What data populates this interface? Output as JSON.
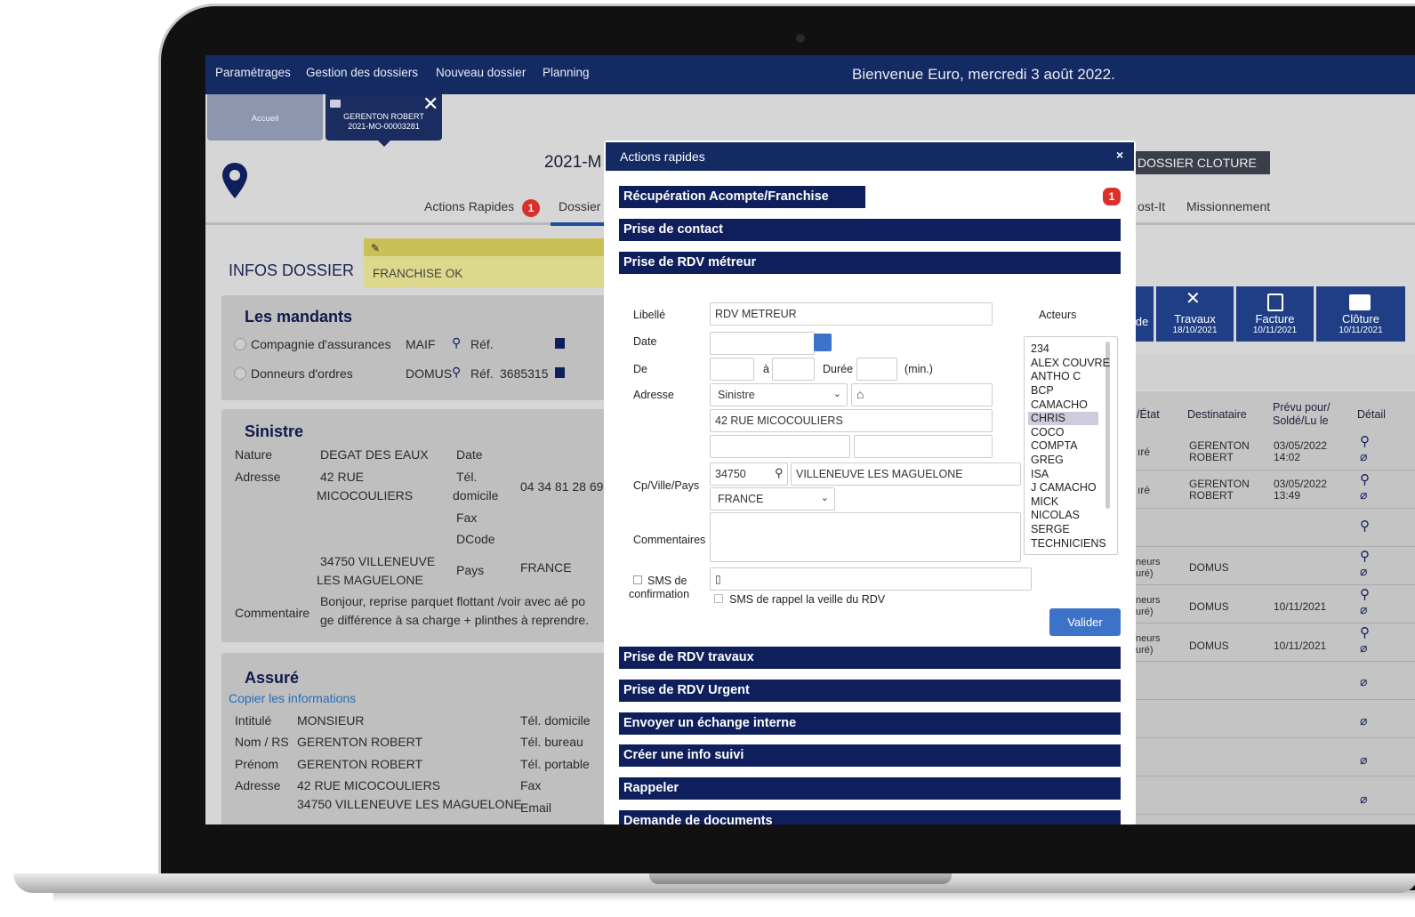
{
  "nav": {
    "items": [
      "Paramétrages",
      "Gestion des dossiers",
      "Nouveau dossier",
      "Planning"
    ],
    "welcome": "Bienvenue Euro, mercredi 3 août 2022."
  },
  "tabs": {
    "home": "Accueil",
    "dossier_line1": "GERENTON ROBERT",
    "dossier_line2": "2021-MO-00003281"
  },
  "dossier": {
    "number": "2021-M",
    "tab_actions": "Actions Rapides",
    "tab_actions_badge": "1",
    "tab_dossier": "Dossier",
    "cloture": "DOSSIER CLOTURE",
    "tab_postit": "ost-It",
    "tab_mission": "Missionnement"
  },
  "infos": {
    "title": "INFOS DOSSIER",
    "postit": "FRANCHISE OK"
  },
  "mandants": {
    "title": "Les mandants",
    "row1_label": "Compagnie d'assurances",
    "row1_value": "MAIF",
    "row1_ref": "Réf.",
    "row2_label": "Donneurs d'ordres",
    "row2_value": "DOMUS",
    "row2_ref": "Réf.",
    "row2_ref_value": "3685315"
  },
  "sinistre": {
    "title": "Sinistre",
    "nature_label": "Nature",
    "nature": "DEGAT DES EAUX",
    "date_label": "Date",
    "adresse_label": "Adresse",
    "adresse1": "42 RUE",
    "adresse2": "MICOCOULIERS",
    "tel_label1": "Tél.",
    "tel_label2": "domicile",
    "tel": "04 34 81 28 69",
    "fax_label": "Fax",
    "dcode_label": "DCode",
    "ville1": "34750 VILLENEUVE",
    "ville2": "LES MAGUELONE",
    "pays_label": "Pays",
    "pays": "FRANCE",
    "comment_label": "Commentaire",
    "comment1": "Bonjour, reprise parquet flottant /voir avec aé po",
    "comment2": "ge différence à sa charge + plinthes à reprendre."
  },
  "assure": {
    "title": "Assuré",
    "copy": "Copier les informations",
    "intitule_label": "Intitulé",
    "intitule": "MONSIEUR",
    "nom_label": "Nom / RS",
    "nom": "GERENTON ROBERT",
    "prenom_label": "Prénom",
    "prenom": "GERENTON ROBERT",
    "adresse_label": "Adresse",
    "adresse1": "42 RUE MICOCOULIERS",
    "adresse2": "34750 VILLENEUVE LES MAGUELONE",
    "tel_dom": "Tél. domicile",
    "tel_bur": "Tél. bureau",
    "tel_port": "Tél. portable",
    "fax": "Fax",
    "email": "Email"
  },
  "right": {
    "btn_partial": "de",
    "btn1_label": "Travaux",
    "btn1_date": "18/10/2021",
    "btn2_label": "Facture",
    "btn2_date": "10/11/2021",
    "btn3_label": "Clôture",
    "btn3_date": "10/11/2021",
    "col_etat": "/État",
    "col_dest": "Destinataire",
    "col_prevu1": "Prévu pour/",
    "col_prevu2": "Soldé/Lu le",
    "col_detail": "Détail",
    "rows": [
      {
        "etat": "ıré",
        "dest1": "GERENTON",
        "dest2": "ROBERT",
        "date1": "03/05/2022",
        "date2": "14:02"
      },
      {
        "etat": "ıré",
        "dest1": "GERENTON",
        "dest2": "ROBERT",
        "date1": "03/05/2022",
        "date2": "13:49"
      },
      {
        "etat": "",
        "dest1": "",
        "dest2": "",
        "date1": "",
        "date2": ""
      },
      {
        "etat": "neurs\nuré)",
        "dest1": "DOMUS",
        "dest2": "",
        "date1": "",
        "date2": ""
      },
      {
        "etat": "neurs\nuré)",
        "dest1": "DOMUS",
        "dest2": "",
        "date1": "10/11/2021",
        "date2": ""
      },
      {
        "etat": "neurs\nuré)",
        "dest1": "DOMUS",
        "dest2": "",
        "date1": "10/11/2021",
        "date2": ""
      }
    ]
  },
  "modal": {
    "title": "Actions rapides",
    "close": "×",
    "sections_top": [
      "Récupération Acompte/Franchise",
      "Prise de contact",
      "Prise de RDV métreur"
    ],
    "badge": "1",
    "form": {
      "libelle_label": "Libellé",
      "libelle_value": "RDV METREUR",
      "date_label": "Date",
      "de_label": "De",
      "a_label": "à",
      "duree_label": "Durée",
      "min_label": "(min.)",
      "adresse_label": "Adresse",
      "adresse_select": "Sinistre",
      "adresse_line": "42 RUE MICOCOULIERS",
      "cp_label": "Cp/Ville/Pays",
      "cp": "34750",
      "ville": "VILLENEUVE LES MAGUELONE",
      "pays": "FRANCE",
      "comment_label": "Commentaires",
      "sms_label1": "SMS de",
      "sms_label2": "confirmation",
      "sms_rappel": "SMS de rappel la veille du RDV",
      "valider": "Valider",
      "acteurs_label": "Acteurs",
      "acteurs": [
        "234",
        "ALEX COUVRE",
        "ANTHO C",
        "BCP",
        "CAMACHO",
        "CHRIS",
        "COCO",
        "COMPTA",
        "GREG",
        "ISA",
        "J CAMACHO",
        "MICK",
        "NICOLAS",
        "SERGE",
        "TECHNICIENS"
      ],
      "acteur_selected": "CHRIS"
    },
    "sections_bottom": [
      "Prise de RDV travaux",
      "Prise de RDV Urgent",
      "Envoyer un échange interne",
      "Créer une info suivi",
      "Rappeler",
      "Demande de documents"
    ]
  },
  "colors": {
    "navy": "#142a63",
    "accent": "#3c73c9",
    "badge": "#d9302a"
  }
}
